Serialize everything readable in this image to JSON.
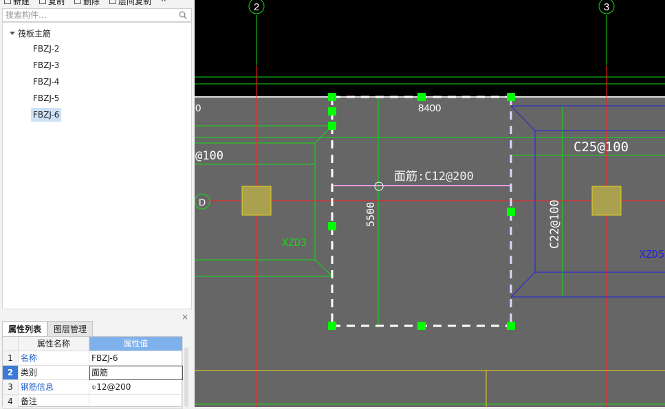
{
  "toolbar": {
    "new_label": "新建",
    "copy_label": "复制",
    "delete_label": "删除",
    "floor_copy_label": "层间复制",
    "more_label": "··"
  },
  "search": {
    "placeholder": "搜索构件..."
  },
  "tree": {
    "root_label": "筏板主筋",
    "items": [
      {
        "label": "FBZJ-2"
      },
      {
        "label": "FBZJ-3"
      },
      {
        "label": "FBZJ-4"
      },
      {
        "label": "FBZJ-5"
      },
      {
        "label": "FBZJ-6",
        "selected": true
      }
    ]
  },
  "panel": {
    "close_label": "×",
    "tabs": [
      {
        "label": "属性列表",
        "active": true
      },
      {
        "label": "图层管理",
        "active": false
      }
    ],
    "table": {
      "header": {
        "name": "属性名称",
        "value": "属性值"
      },
      "rows": [
        {
          "index": "1",
          "name": "名称",
          "value": "FBZJ-6"
        },
        {
          "index": "2",
          "name": "类别",
          "value": "面筋"
        },
        {
          "index": "3",
          "name": "钢筋信息",
          "value": "⌽12@200"
        },
        {
          "index": "4",
          "name": "备注",
          "value": ""
        }
      ]
    }
  },
  "cad": {
    "axis_labels": [
      "2",
      "3",
      "D"
    ],
    "dim_horizontal": "8400",
    "dim_vertical": "5500",
    "left_dim_fragment": "0",
    "left_rebar_fragment": "@100",
    "rebar_left": "XZD3",
    "rebar_right": "XZD5",
    "rebar_c25": "C25@100",
    "rebar_c22": "C22@100",
    "selected_rebar": "面筋:C12@200",
    "colors": {
      "background_top": "#000000",
      "slab": "#666666",
      "axis_red": "#ff2020",
      "green": "#11dd11",
      "blue": "#2222dd",
      "selection_handle": "#00ff00",
      "column_yellow": "#e8d020"
    }
  }
}
